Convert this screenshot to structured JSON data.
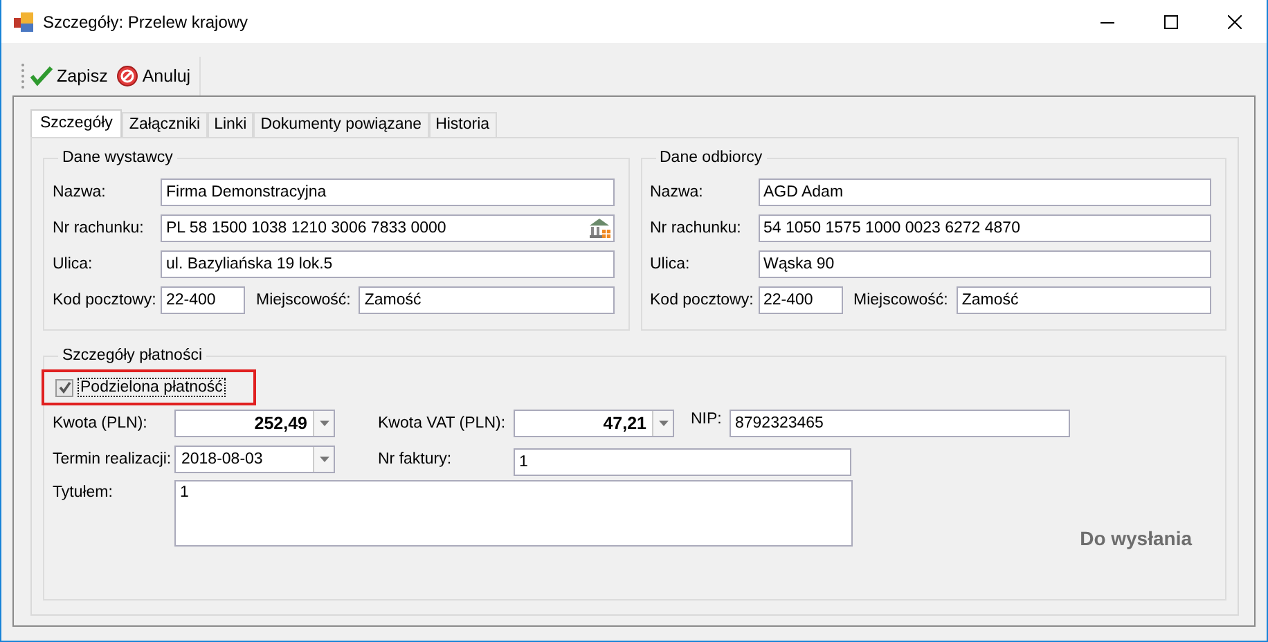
{
  "window": {
    "title": "Szczegóły: Przelew krajowy"
  },
  "toolbar": [
    {
      "label": "Zapisz",
      "kind": "save"
    },
    {
      "label": "Anuluj",
      "kind": "cancel"
    }
  ],
  "tabs": [
    {
      "label": "Szczegóły",
      "selected": true
    },
    {
      "label": "Załączniki",
      "selected": false
    },
    {
      "label": "Linki",
      "selected": false
    },
    {
      "label": "Dokumenty powiązane",
      "selected": false
    },
    {
      "label": "Historia",
      "selected": false
    }
  ],
  "parties": [
    {
      "title": "Dane wystawcy",
      "name": {
        "label": "Nazwa:",
        "value": "Firma Demonstracyjna"
      },
      "account": {
        "label": "Nr rachunku:",
        "value": "PL 58 1500 1038 1210 3006 7833 0000",
        "bank_button": true
      },
      "street": {
        "label": "Ulica:",
        "value": "ul. Bazyliańska 19 lok.5"
      },
      "postal_code": {
        "label": "Kod pocztowy:",
        "value": "22-400"
      },
      "city": {
        "label": "Miejscowość:",
        "value": "Zamość"
      }
    },
    {
      "title": "Dane odbiorcy",
      "name": {
        "label": "Nazwa:",
        "value": "AGD Adam"
      },
      "account": {
        "label": "Nr rachunku:",
        "value": "54 1050 1575 1000 0023 6272 4870",
        "bank_button": false
      },
      "street": {
        "label": "Ulica:",
        "value": "Wąska 90"
      },
      "postal_code": {
        "label": "Kod pocztowy:",
        "value": "22-400"
      },
      "city": {
        "label": "Miejscowość:",
        "value": "Zamość"
      }
    }
  ],
  "payment": {
    "title": "Szczegóły płatności",
    "split_payment": {
      "label": "Podzielona płatność",
      "checked": true,
      "highlighted": true
    },
    "amount": {
      "label": "Kwota (PLN):",
      "value": "252,49"
    },
    "vat_amount": {
      "label": "Kwota VAT (PLN):",
      "value": "47,21"
    },
    "nip": {
      "label": "NIP:",
      "value": "8792323465"
    },
    "due_date": {
      "label": "Termin realizacji:",
      "value": "2018-08-03"
    },
    "invoice_number": {
      "label": "Nr faktury:",
      "value": "1"
    },
    "transfer_title": {
      "label": "Tytułem:",
      "value": "1"
    },
    "status": "Do wysłania"
  }
}
